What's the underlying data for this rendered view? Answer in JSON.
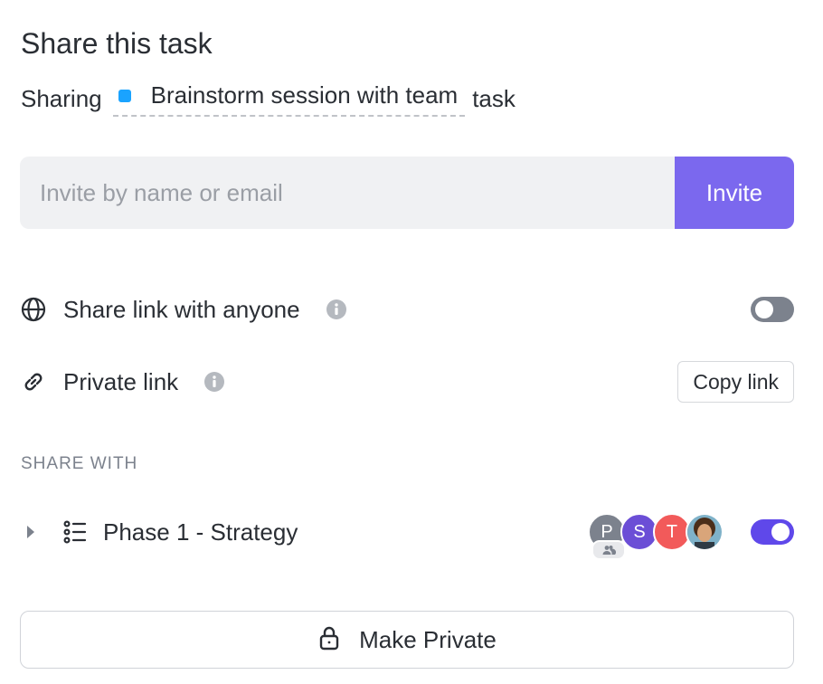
{
  "title": "Share this task",
  "sharing": {
    "prefix": "Sharing",
    "task_name": "Brainstorm session with team",
    "suffix": "task",
    "task_color": "#1aa3ff"
  },
  "invite": {
    "placeholder": "Invite by name or email",
    "button_label": "Invite",
    "button_color": "#7b68ee"
  },
  "share_link_anyone": {
    "icon": "globe-icon",
    "label": "Share link with anyone",
    "info_icon": "info-icon",
    "enabled": false
  },
  "private_link": {
    "icon": "link-icon",
    "label": "Private link",
    "info_icon": "info-icon",
    "copy_label": "Copy link"
  },
  "share_with": {
    "section_label": "SHARE WITH",
    "items": [
      {
        "icon": "list-icon",
        "label": "Phase 1 - Strategy",
        "enabled": true,
        "avatars": [
          {
            "initial": "P",
            "color": "#7c828d",
            "has_team_badge": true
          },
          {
            "initial": "S",
            "color": "#6b4ed6"
          },
          {
            "initial": "T",
            "color": "#f25a5a"
          },
          {
            "initial": "",
            "color": "#c98a4b",
            "is_photo": true
          }
        ]
      }
    ]
  },
  "make_private": {
    "icon": "lock-icon",
    "label": "Make Private"
  },
  "colors": {
    "toggle_off": "#7c828d",
    "toggle_on": "#5f48ea"
  }
}
